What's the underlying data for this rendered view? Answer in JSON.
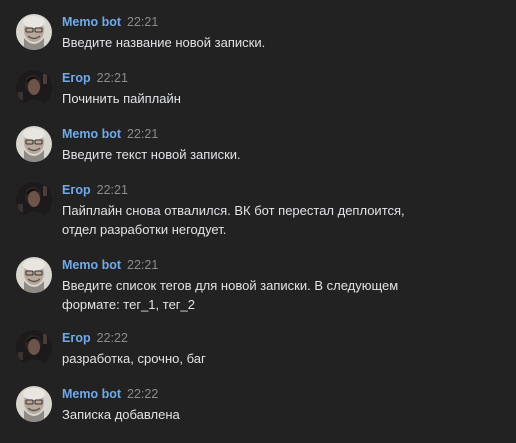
{
  "messages": [
    {
      "author": "Memo bot",
      "time": "22:21",
      "avatar": "bot-avatar",
      "lines": [
        "Введите название новой записки."
      ]
    },
    {
      "author": "Егор",
      "time": "22:21",
      "avatar": "user-avatar",
      "lines": [
        "Починить пайплайн"
      ]
    },
    {
      "author": "Memo bot",
      "time": "22:21",
      "avatar": "bot-avatar",
      "lines": [
        "Введите текст новой записки."
      ]
    },
    {
      "author": "Егор",
      "time": "22:21",
      "avatar": "user-avatar",
      "lines": [
        "Пайплайн снова отвалился. ВК бот перестал деплоится,",
        "отдел разработки негодует."
      ]
    },
    {
      "author": "Memo bot",
      "time": "22:21",
      "avatar": "bot-avatar",
      "lines": [
        "Введите список тегов для новой записки. В следующем",
        "формате: тег_1, тег_2"
      ]
    },
    {
      "author": "Егор",
      "time": "22:22",
      "avatar": "user-avatar",
      "lines": [
        "разработка, срочно, баг"
      ]
    },
    {
      "author": "Memo bot",
      "time": "22:22",
      "avatar": "bot-avatar",
      "lines": [
        "Записка добавлена"
      ]
    }
  ],
  "colors": {
    "background": "#222222",
    "author": "#71aaeb",
    "time": "#8a8c8f",
    "text": "#e1e3e6"
  }
}
